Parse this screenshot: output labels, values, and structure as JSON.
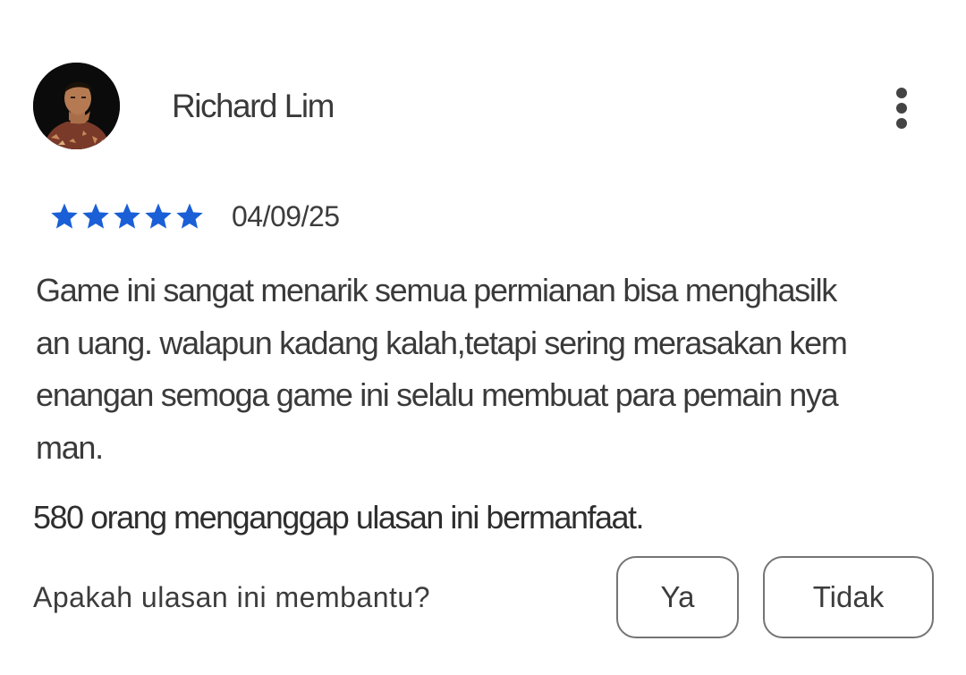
{
  "review": {
    "reviewer_name": "Richard Lim",
    "avatar_icon": "profile-photo",
    "more_icon": "more-vertical-icon",
    "rating": 5,
    "rating_max": 5,
    "star_color": "#1a5fd6",
    "date": "04/09/25",
    "text_lines": [
      "Game ini sangat menarik semua permianan bisa menghasilk",
      "an uang. walapun kadang kalah,tetapi sering merasakan kem",
      "enangan semoga game ini selalu membuat para pemain nya",
      "man."
    ],
    "helpful_count_text": "580 orang menganggap ulasan ini bermanfaat.",
    "helpful_question": "Apakah ulasan ini membantu?",
    "yes_label": "Ya",
    "no_label": "Tidak"
  }
}
